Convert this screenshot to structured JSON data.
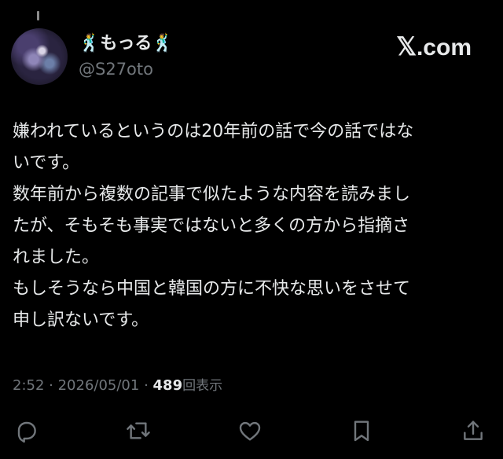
{
  "tweet": {
    "author": {
      "display_name": "🕺もっる🕺",
      "handle": "@S27oto"
    },
    "brand": {
      "x_glyph": "𝕏",
      "suffix": ".com"
    },
    "text_lines": [
      "嫌われているというのは20年前の話で今の話ではな",
      "いです。",
      "数年前から複数の記事で似たような内容を読みまし",
      "たが、そもそも事実ではないと多くの方から指摘さ",
      "れました。",
      "もしそうなら中国と韓国の方に不快な思いをさせて",
      "申し訳ないです。"
    ],
    "meta": {
      "time": "2:52",
      "separator_1": " · ",
      "date": "2026/05/01",
      "separator_2": " · ",
      "views_count": "489",
      "views_label": "回表示"
    },
    "actions": [
      {
        "name": "reply",
        "icon": "reply-icon"
      },
      {
        "name": "repost",
        "icon": "repost-icon"
      },
      {
        "name": "like",
        "icon": "heart-icon"
      },
      {
        "name": "bookmark",
        "icon": "bookmark-icon"
      },
      {
        "name": "share",
        "icon": "share-icon"
      }
    ],
    "colors": {
      "background": "#000000",
      "primary_text": "#e7e9ea",
      "secondary_text": "#71767b",
      "icon": "#71767b"
    }
  }
}
